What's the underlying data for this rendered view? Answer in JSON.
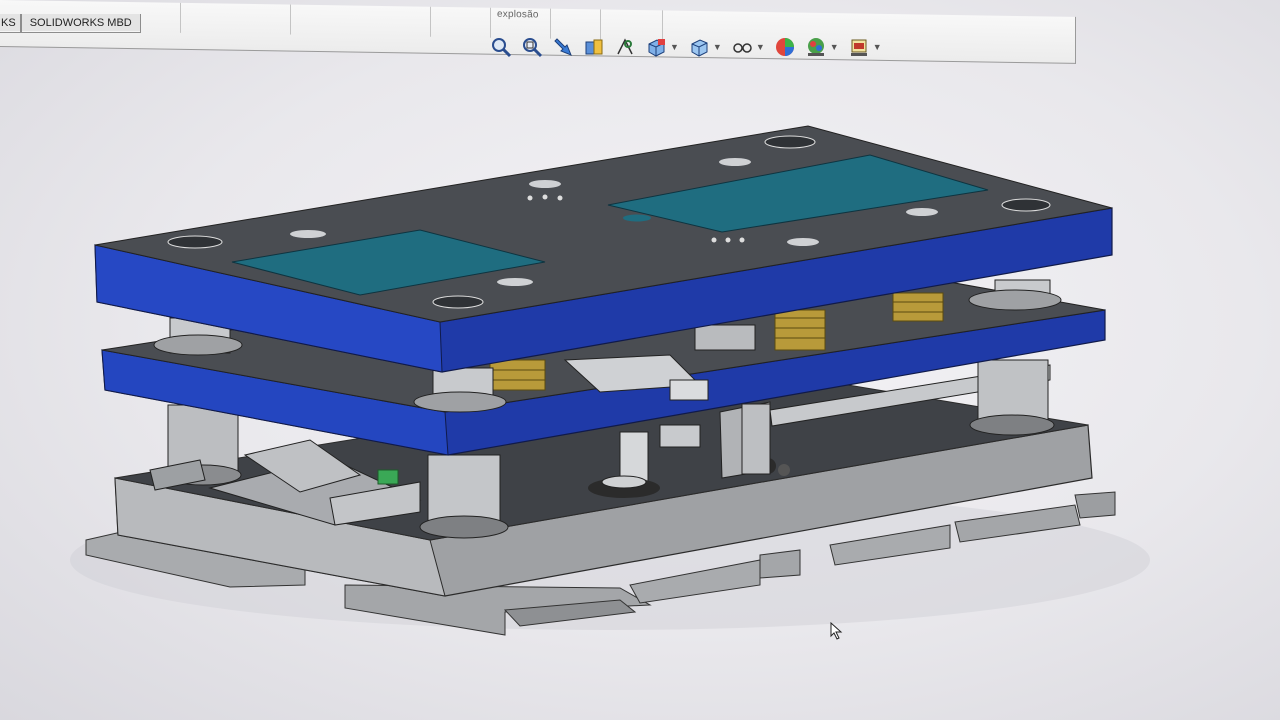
{
  "ribbon": {
    "group_label": "explosão"
  },
  "tabs": [
    {
      "label": "KS"
    },
    {
      "label": "SOLIDWORKS MBD"
    }
  ],
  "view_toolbar": {
    "items": [
      {
        "icon": "zoom-to-fit-icon"
      },
      {
        "icon": "zoom-to-area-icon"
      },
      {
        "icon": "previous-view-icon"
      },
      {
        "icon": "section-view-icon"
      },
      {
        "icon": "dynamic-annotation-view-icon"
      },
      {
        "icon": "view-orientation-icon",
        "dropdown": true
      },
      {
        "icon": "display-style-icon",
        "dropdown": true
      },
      {
        "icon": "hide-show-items-icon",
        "dropdown": true
      },
      {
        "icon": "edit-appearance-icon"
      },
      {
        "icon": "apply-scene-icon",
        "dropdown": true
      },
      {
        "icon": "view-settings-icon",
        "dropdown": true
      }
    ]
  },
  "model": {
    "description_colors": {
      "plate_top": "#1f3aa8",
      "plate_face": "#4a4d52",
      "insert": "#1f6d80",
      "spring": "#b89a3a",
      "base": "#9a9c9f"
    }
  }
}
